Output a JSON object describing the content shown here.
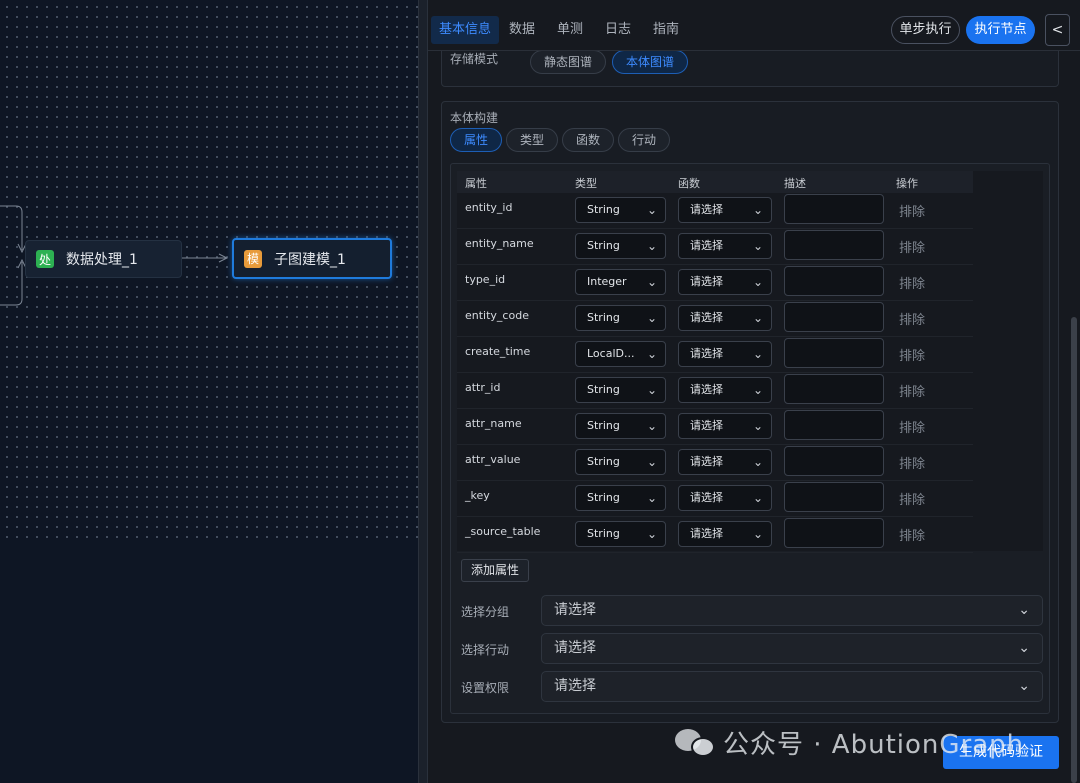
{
  "canvas": {
    "nodes": [
      {
        "badge": "处",
        "label": "数据处理_1",
        "badge_color": "#2db152"
      },
      {
        "badge": "模",
        "label": "子图建模_1",
        "badge_color": "#e89b3b"
      }
    ]
  },
  "header": {
    "tabs": [
      "基本信息",
      "数据",
      "单测",
      "日志",
      "指南"
    ],
    "active_tab": "基本信息",
    "step_button": "单步执行",
    "exec_button": "执行节点",
    "collapse_button": "<"
  },
  "storage": {
    "label": "存储模式",
    "options": [
      "静态图谱",
      "本体图谱"
    ],
    "selected": "本体图谱"
  },
  "ontology": {
    "title": "本体构建",
    "tabs": [
      "属性",
      "类型",
      "函数",
      "行动"
    ],
    "active_tab": "属性",
    "columns": [
      "属性",
      "类型",
      "函数",
      "描述",
      "操作"
    ],
    "rows": [
      {
        "name": "entity_id",
        "type": "String",
        "func": "请选择",
        "action": "排除"
      },
      {
        "name": "entity_name",
        "type": "String",
        "func": "请选择",
        "action": "排除"
      },
      {
        "name": "type_id",
        "type": "Integer",
        "func": "请选择",
        "action": "排除"
      },
      {
        "name": "entity_code",
        "type": "String",
        "func": "请选择",
        "action": "排除"
      },
      {
        "name": "create_time",
        "type": "LocalD...",
        "func": "请选择",
        "action": "排除"
      },
      {
        "name": "attr_id",
        "type": "String",
        "func": "请选择",
        "action": "排除"
      },
      {
        "name": "attr_name",
        "type": "String",
        "func": "请选择",
        "action": "排除"
      },
      {
        "name": "attr_value",
        "type": "String",
        "func": "请选择",
        "action": "排除"
      },
      {
        "name": "_key",
        "type": "String",
        "func": "请选择",
        "action": "排除"
      },
      {
        "name": "_source_table",
        "type": "String",
        "func": "请选择",
        "action": "排除"
      }
    ],
    "add_button": "添加属性",
    "group": {
      "label": "选择分组",
      "value": "请选择"
    },
    "action": {
      "label": "选择行动",
      "value": "请选择"
    },
    "permission": {
      "label": "设置权限",
      "value": "请选择"
    }
  },
  "footer": {
    "generate_button": "生成代码验证"
  },
  "watermark": {
    "text": "公众号 · AbutionGraph"
  },
  "colors": {
    "accent": "#1a73f0",
    "active_text": "#3d8bff",
    "canvas_bg": "#0e1624",
    "panel_bg": "#16191f"
  }
}
